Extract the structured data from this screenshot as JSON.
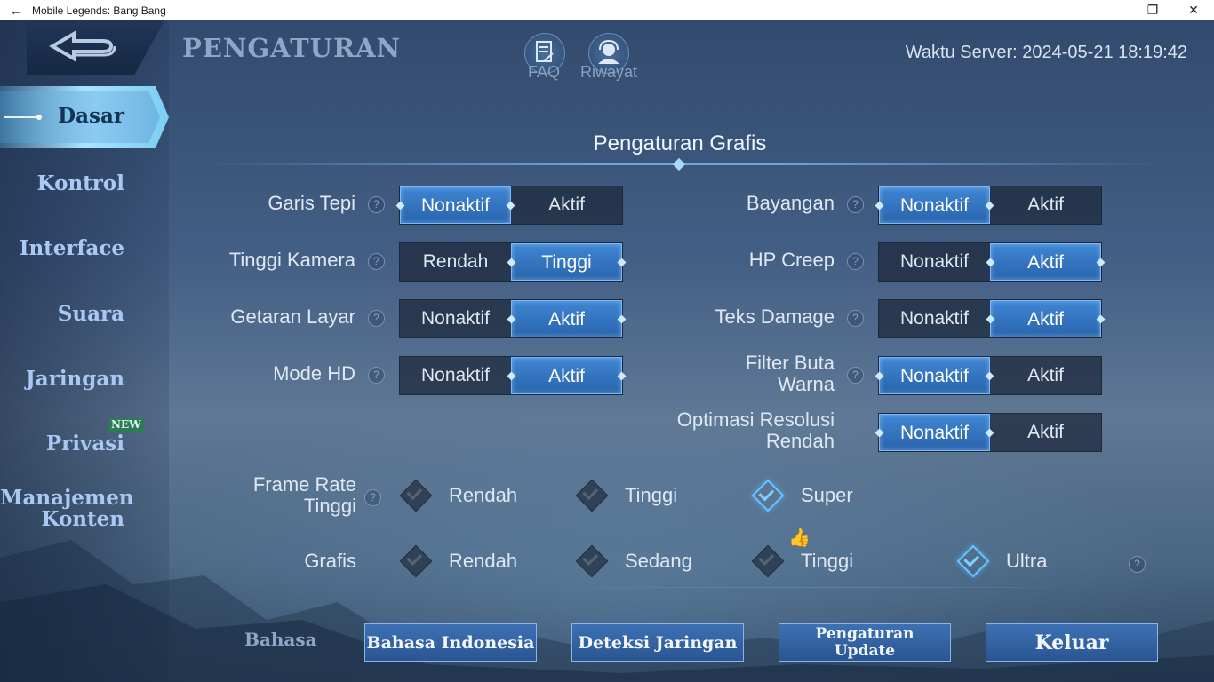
{
  "window": {
    "title": "Mobile Legends: Bang Bang",
    "back_glyph": "←",
    "minimize_glyph": "—",
    "restore_glyph": "❐",
    "close_glyph": "✕"
  },
  "header": {
    "title": "PENGATURAN",
    "faq_label": "FAQ",
    "history_label": "Riwayat",
    "server_time": "Waktu Server: 2024-05-21 18:19:42"
  },
  "sidebar": {
    "active": "Dasar",
    "items": [
      "Kontrol",
      "Interface",
      "Suara",
      "Jaringan",
      "Privasi",
      "Manajemen Konten"
    ],
    "new_badge": "NEW"
  },
  "section": {
    "title": "Pengaturan Grafis"
  },
  "help_glyph": "?",
  "toggles_left": [
    {
      "label": "Garis Tepi",
      "off": "Nonaktif",
      "on": "Aktif",
      "selected": "off"
    },
    {
      "label": "Tinggi Kamera",
      "off": "Rendah",
      "on": "Tinggi",
      "selected": "on"
    },
    {
      "label": "Getaran Layar",
      "off": "Nonaktif",
      "on": "Aktif",
      "selected": "on"
    },
    {
      "label": "Mode HD",
      "off": "Nonaktif",
      "on": "Aktif",
      "selected": "on"
    }
  ],
  "toggles_right": [
    {
      "label": "Bayangan",
      "off": "Nonaktif",
      "on": "Aktif",
      "selected": "off"
    },
    {
      "label": "HP Creep",
      "off": "Nonaktif",
      "on": "Aktif",
      "selected": "on"
    },
    {
      "label": "Teks Damage",
      "off": "Nonaktif",
      "on": "Aktif",
      "selected": "on"
    },
    {
      "label": "Filter Buta Warna",
      "off": "Nonaktif",
      "on": "Aktif",
      "selected": "off"
    },
    {
      "label": "Optimasi Resolusi Rendah",
      "off": "Nonaktif",
      "on": "Aktif",
      "selected": "off"
    }
  ],
  "frame_rate": {
    "label": "Frame Rate Tinggi",
    "options": [
      "Rendah",
      "Tinggi",
      "Super"
    ],
    "selected": "Super"
  },
  "graphics": {
    "label": "Grafis",
    "options": [
      "Rendah",
      "Sedang",
      "Tinggi",
      "Ultra"
    ],
    "selected": "Ultra",
    "recommended_icon": "thumbs-up-icon",
    "recommended_glyph": "👍"
  },
  "bottom": {
    "language_label": "Bahasa",
    "language_button": "Bahasa Indonesia",
    "network_button": "Deteksi Jaringan",
    "update_button": "Pengaturan Update",
    "exit_button": "Keluar"
  },
  "colors": {
    "accent": "#3f86d3",
    "active_nav": "#8ccaf0"
  }
}
